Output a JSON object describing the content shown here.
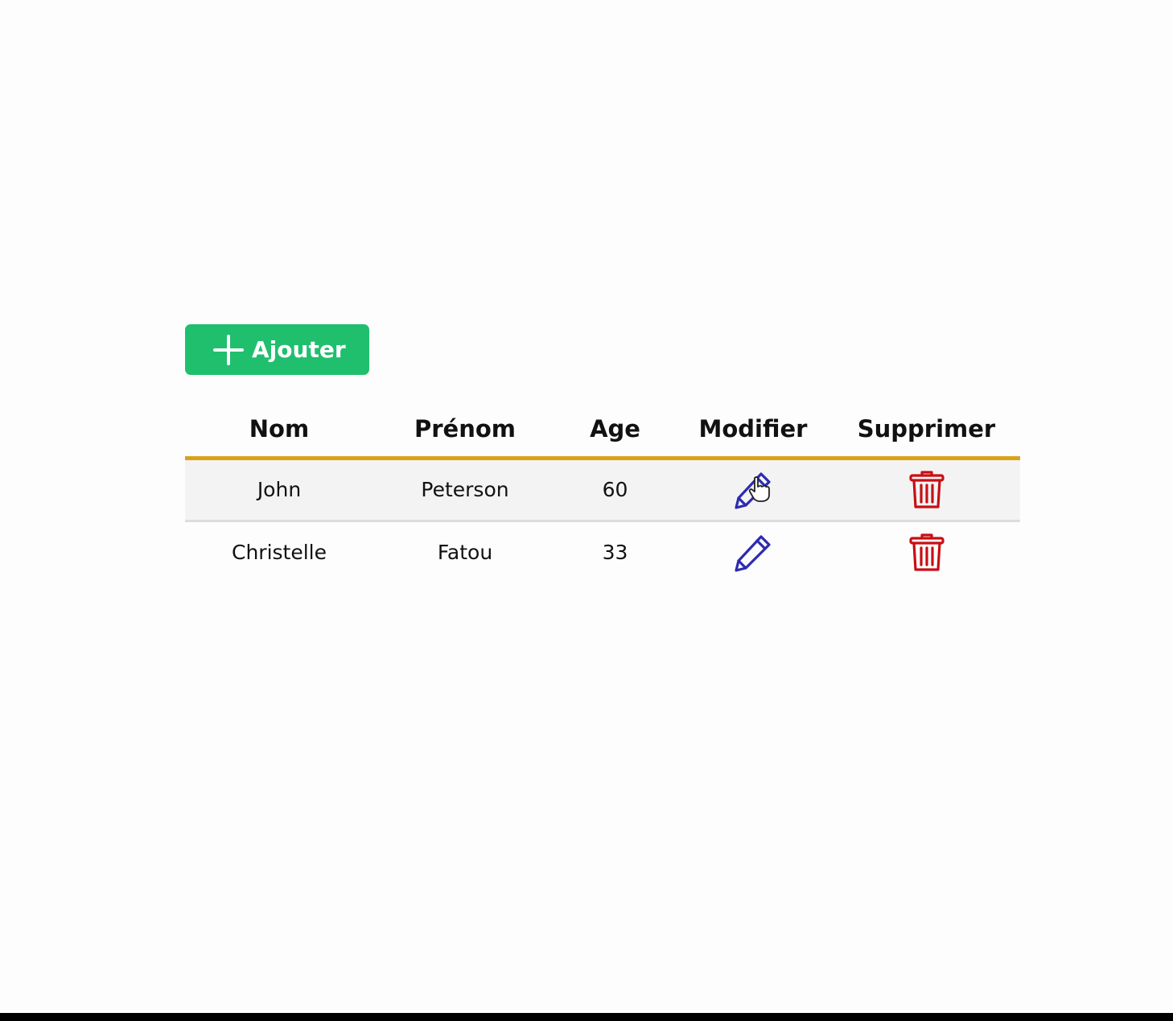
{
  "toolbar": {
    "add_label": "Ajouter",
    "add_icon": "plus-icon"
  },
  "table": {
    "columns": [
      "Nom",
      "Prénom",
      "Age",
      "Modifier",
      "Supprimer"
    ],
    "rows": [
      {
        "nom": "John",
        "prenom": "Peterson",
        "age": "60"
      },
      {
        "nom": "Christelle",
        "prenom": "Fatou",
        "age": "33"
      }
    ],
    "edit_icon": "pencil-icon",
    "delete_icon": "trash-icon"
  },
  "colors": {
    "add_button": "#1fbf6e",
    "header_underline": "#d9a21b",
    "edit_icon": "#2d2bb0",
    "delete_icon": "#c80f14"
  }
}
